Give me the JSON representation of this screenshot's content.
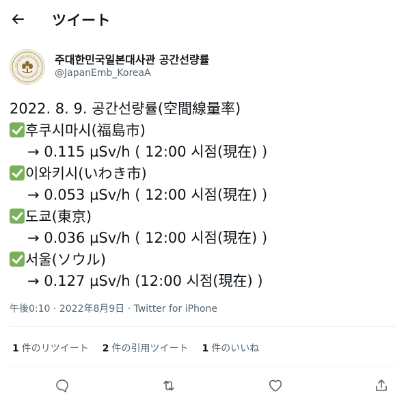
{
  "header": {
    "title": "ツイート",
    "back_icon": "arrow-left-icon"
  },
  "author": {
    "name": "주대한민국일본대사관 공간선량률",
    "handle": "@JapanEmb_KoreaA",
    "avatar_seal_text": "EMBASSY OF JAPAN SEOUL KOREA"
  },
  "tweet": {
    "headline": "2022. 8. 9. 공간선량률(空間線量率)",
    "entries": [
      {
        "place": "후쿠시마시(福島市)",
        "reading": "→ 0.115 µSv/h ( 12:00 시점(現在) )"
      },
      {
        "place": "이와키시(いわき市)",
        "reading": "→ 0.053 µSv/h ( 12:00 시점(現在) )"
      },
      {
        "place": "도쿄(東京)",
        "reading": "→ 0.036 µSv/h ( 12:00 시점(現在) )"
      },
      {
        "place": "서울(ソウル)",
        "reading": "→ 0.127 µSv/h  (12:00 시점(現在) )"
      }
    ]
  },
  "meta": {
    "time": "午後0:10",
    "date": "2022年8月9日",
    "source": "Twitter for iPhone",
    "separator": " · "
  },
  "stats": {
    "retweets_count": "1",
    "retweets_label": "件のリツイート",
    "quotes_count": "2",
    "quotes_label": "件の引用ツイート",
    "likes_count": "1",
    "likes_label": "件のいいね"
  },
  "actions": [
    "reply-icon",
    "retweet-icon",
    "like-icon",
    "share-icon"
  ],
  "colors": {
    "text": "#0f1419",
    "secondary": "#536471",
    "divider": "#eff3f4",
    "check": "#78b159"
  }
}
